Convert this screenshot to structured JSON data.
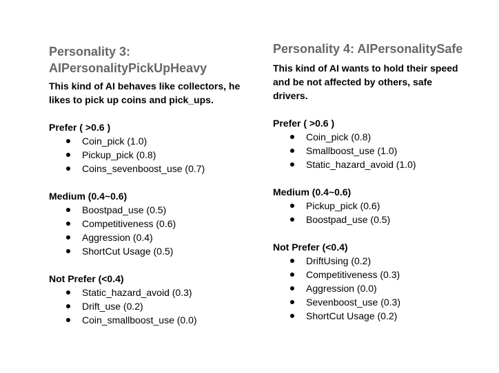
{
  "left": {
    "title": "Personality 3: AIPersonalityPickUpHeavy",
    "description": "This kind of AI behaves like collectors, he likes to pick up coins and pick_ups.",
    "prefer": {
      "heading": "Prefer ( >0.6 )",
      "items": [
        "Coin_pick (1.0)",
        "Pickup_pick (0.8)",
        "Coins_sevenboost_use (0.7)"
      ]
    },
    "medium": {
      "heading": "Medium (0.4~0.6)",
      "items": [
        "Boostpad_use (0.5)",
        "Competitiveness (0.6)",
        "Aggression (0.4)",
        "ShortCut Usage (0.5)"
      ]
    },
    "not_prefer": {
      "heading": "Not Prefer (<0.4)",
      "items": [
        "Static_hazard_avoid (0.3)",
        "Drift_use (0.2)",
        "Coin_smallboost_use (0.0)"
      ]
    }
  },
  "right": {
    "title": "Personality 4: AIPersonalitySafe",
    "description": "This kind of AI wants to hold their speed and be not affected by others, safe drivers.",
    "prefer": {
      "heading": "Prefer ( >0.6 )",
      "items": [
        "Coin_pick (0.8)",
        "Smallboost_use (1.0)",
        "Static_hazard_avoid (1.0)"
      ]
    },
    "medium": {
      "heading": "Medium (0.4~0.6)",
      "items": [
        "Pickup_pick (0.6)",
        "Boostpad_use (0.5)"
      ]
    },
    "not_prefer": {
      "heading": "Not Prefer (<0.4)",
      "items": [
        "DriftUsing (0.2)",
        "Competitiveness (0.3)",
        "Aggression (0.0)",
        "Sevenboost_use (0.3)",
        "ShortCut Usage (0.2)"
      ]
    }
  }
}
